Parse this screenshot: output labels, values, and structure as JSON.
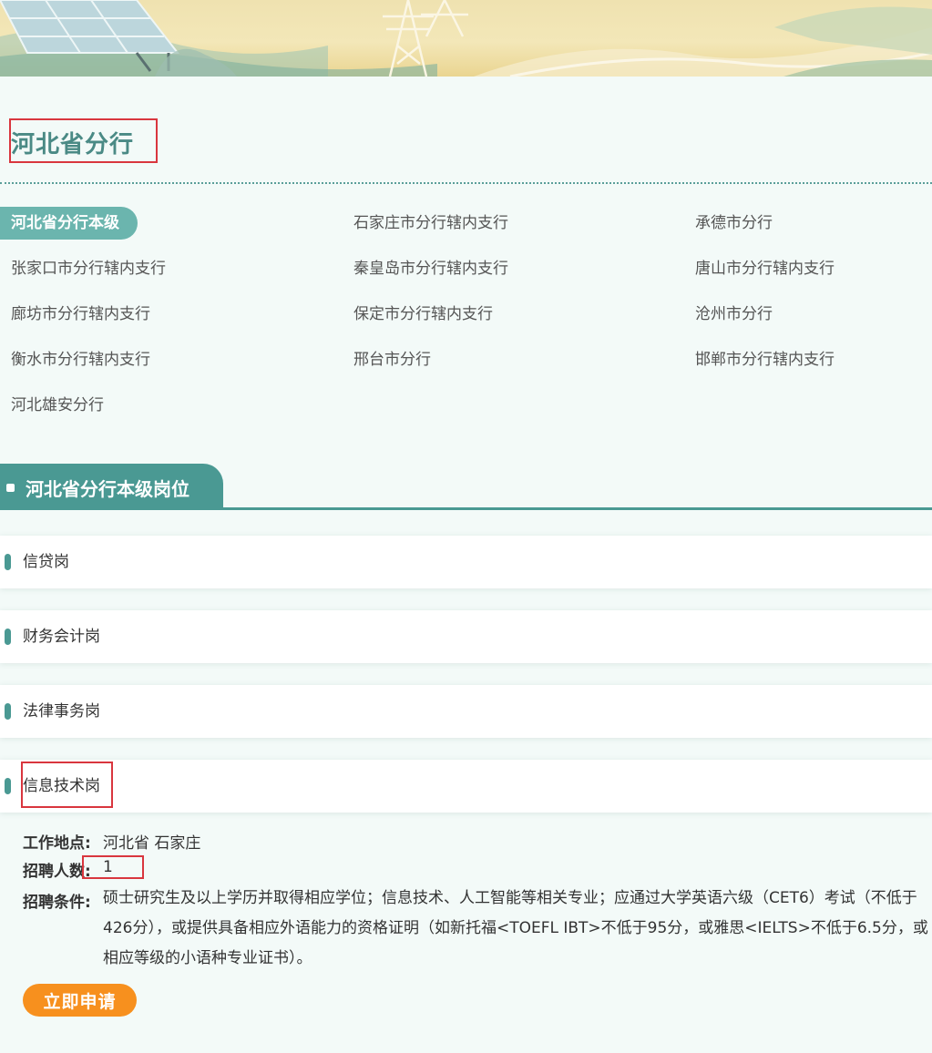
{
  "region": {
    "title": "河北省分行"
  },
  "branches": [
    {
      "label": "河北省分行本级",
      "active": true
    },
    {
      "label": "石家庄市分行辖内支行"
    },
    {
      "label": "承德市分行"
    },
    {
      "label": "张家口市分行辖内支行"
    },
    {
      "label": "秦皇岛市分行辖内支行"
    },
    {
      "label": "唐山市分行辖内支行"
    },
    {
      "label": "廊坊市分行辖内支行"
    },
    {
      "label": "保定市分行辖内支行"
    },
    {
      "label": "沧州市分行"
    },
    {
      "label": "衡水市分行辖内支行"
    },
    {
      "label": "邢台市分行"
    },
    {
      "label": "邯郸市分行辖内支行"
    },
    {
      "label": "河北雄安分行"
    }
  ],
  "section": {
    "title": "河北省分行本级岗位"
  },
  "jobs": [
    {
      "name": "信贷岗"
    },
    {
      "name": "财务会计岗"
    },
    {
      "name": "法律事务岗"
    },
    {
      "name": "信息技术岗",
      "expanded": true
    }
  ],
  "job_detail": {
    "location_label": "工作地点:",
    "location_value": "河北省 石家庄",
    "headcount_label": "招聘人数:",
    "headcount_value": "1",
    "requirements_label": "招聘条件:",
    "requirements_lines": [
      "硕士研究生及以上学历并取得相应学位；信息技术、人工智能等相关专业；应通过大学英语六级（CET6）考试（不低于",
      "426分），或提供具备相应外语能力的资格证明（如新托福<TOEFL IBT>不低于95分，或雅思<IELTS>不低于6.5分，或",
      "相应等级的小语种专业证书）。"
    ],
    "apply_label": "立即申请"
  },
  "colors": {
    "accent": "#4a9993",
    "apply": "#f7901e",
    "highlight": "#d9363e"
  }
}
